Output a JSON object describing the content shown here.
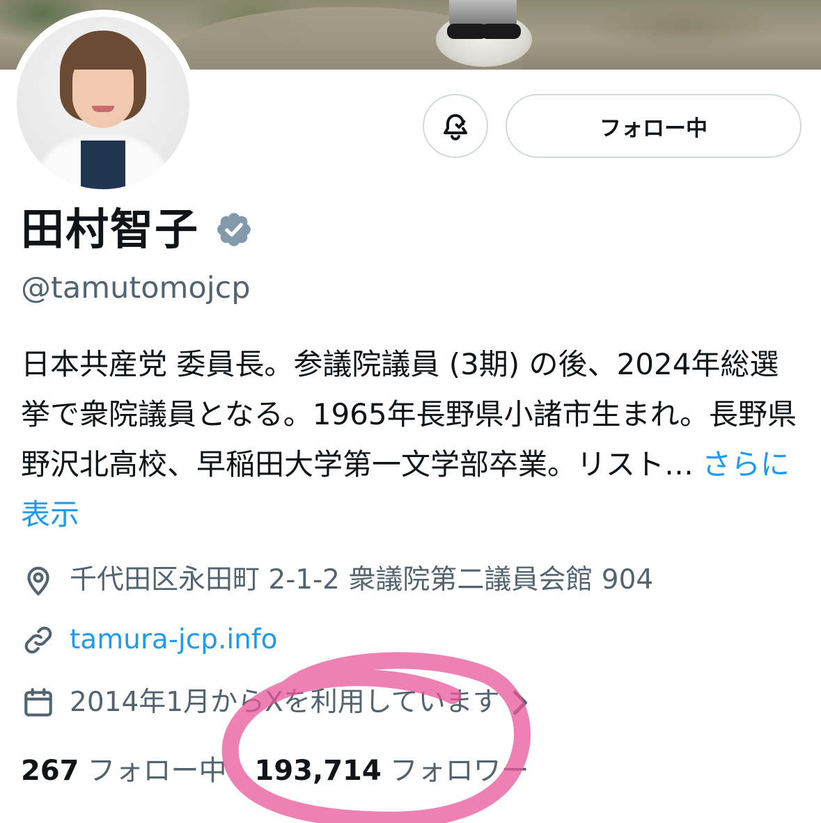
{
  "header": {
    "follow_button_label": "フォロー中"
  },
  "profile": {
    "display_name": "田村智子",
    "handle": "@tamutomojcp",
    "bio_text": "日本共産党 委員長。参議院議員 (3期) の後、2024年総選挙で衆院議員となる。1965年長野県小諸市生まれ。長野県野沢北高校、早稲田大学第一文学部卒業。リスト…",
    "bio_more": "さらに表示",
    "location": "千代田区永田町 2-1-2 衆議院第二議員会館 904",
    "website": "tamura-jcp.info",
    "joined": "2014年1月からXを利用しています"
  },
  "stats": {
    "following_count": "267",
    "following_label": "フォロー中",
    "followers_count": "193,714",
    "followers_label": "フォロワー"
  },
  "colors": {
    "accent": "#1d9bf0",
    "secondary_text": "#536471",
    "verified_badge": "#829aab",
    "annotation": "#e8559a"
  },
  "icons": {
    "notification": "bell-check-icon",
    "verified": "verified-badge-icon",
    "location": "location-pin-icon",
    "website": "link-icon",
    "joined": "calendar-icon",
    "expand": "chevron-right-icon"
  }
}
